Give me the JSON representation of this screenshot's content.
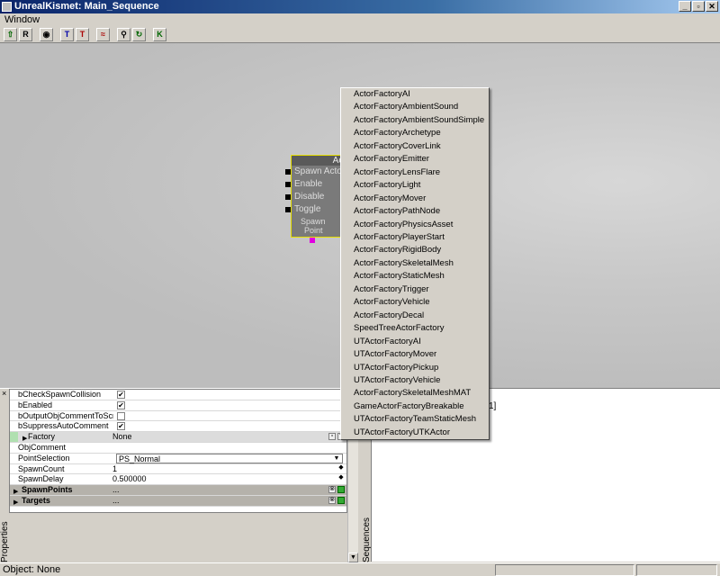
{
  "window": {
    "title": "UnrealKismet: Main_Sequence",
    "buttons": [
      "_",
      "▫",
      "✕"
    ]
  },
  "menu": {
    "items": [
      "Window"
    ]
  },
  "toolbar": {
    "buttons": [
      {
        "name": "parent-sequence-icon",
        "glyph": "⇧"
      },
      {
        "name": "rename-icon",
        "glyph": "R"
      },
      {
        "name": "eye-icon",
        "glyph": "◉"
      },
      {
        "name": "text-tool-icon",
        "glyph": "T"
      },
      {
        "name": "text-color-icon",
        "glyph": "T"
      },
      {
        "name": "wave-icon",
        "glyph": "≈"
      },
      {
        "name": "search-icon",
        "glyph": "⚲"
      },
      {
        "name": "update-icon",
        "glyph": "↻"
      },
      {
        "name": "k-icon",
        "glyph": "K"
      }
    ]
  },
  "node": {
    "title": "Actor",
    "inputs": [
      "Spawn Actor",
      "Enable",
      "Disable",
      "Toggle"
    ],
    "bottom_label_1": "Spawn",
    "bottom_label_2": "Point",
    "right_fragment": "S"
  },
  "properties": {
    "rows": [
      {
        "name": "bCheckSpawnCollision",
        "type": "check",
        "checked": true
      },
      {
        "name": "bEnabled",
        "type": "check",
        "checked": true
      },
      {
        "name": "bOutputObjCommentToScreen",
        "type": "check",
        "checked": false
      },
      {
        "name": "bSuppressAutoComment",
        "type": "check",
        "checked": true
      },
      {
        "name": "Factory",
        "type": "object",
        "value": "None",
        "selected": true,
        "expandable": true
      },
      {
        "name": "ObjComment",
        "type": "text",
        "value": ""
      },
      {
        "name": "PointSelection",
        "type": "dropdown",
        "value": "PS_Normal"
      },
      {
        "name": "SpawnCount",
        "type": "number",
        "value": "1"
      },
      {
        "name": "SpawnDelay",
        "type": "number",
        "value": "0.500000"
      },
      {
        "name": "SpawnPoints",
        "type": "category",
        "value": "..."
      },
      {
        "name": "Targets",
        "type": "category",
        "value": "..."
      }
    ],
    "panel_label": "Properties"
  },
  "sequences": {
    "panel_label": "Sequences",
    "fragment": "1]"
  },
  "dropdown": {
    "items": [
      "ActorFactoryAI",
      "ActorFactoryAmbientSound",
      "ActorFactoryAmbientSoundSimple",
      "ActorFactoryArchetype",
      "ActorFactoryCoverLink",
      "ActorFactoryEmitter",
      "ActorFactoryLensFlare",
      "ActorFactoryLight",
      "ActorFactoryMover",
      "ActorFactoryPathNode",
      "ActorFactoryPhysicsAsset",
      "ActorFactoryPlayerStart",
      "ActorFactoryRigidBody",
      "ActorFactorySkeletalMesh",
      "ActorFactoryStaticMesh",
      "ActorFactoryTrigger",
      "ActorFactoryVehicle",
      "ActorFactoryDecal",
      "SpeedTreeActorFactory",
      "UTActorFactoryAI",
      "UTActorFactoryMover",
      "UTActorFactoryPickup",
      "UTActorFactoryVehicle",
      "ActorFactorySkeletalMeshMAT",
      "GameActorFactoryBreakable",
      "UTActorFactoryTeamStaticMesh",
      "UTActorFactoryUTKActor"
    ]
  },
  "status": {
    "text": "Object: None"
  }
}
